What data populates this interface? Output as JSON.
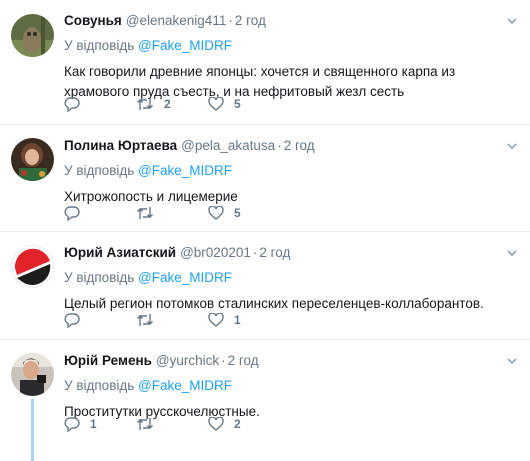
{
  "tweets": [
    {
      "name": "Совунья",
      "handle": "@elenakenig411",
      "time": "2 год",
      "reply_prefix": "У відповідь",
      "reply_to": "@Fake_MIDRF",
      "text": "Как говорили древние японцы: хочется и  священного карпа из храмового пруда съесть, и  на нефритовый жезл сесть",
      "reply_count": "",
      "retweet_count": "2",
      "like_count": "5"
    },
    {
      "name": "Полина Юртаева",
      "handle": "@pela_akatusa",
      "time": "2 год",
      "reply_prefix": "У відповідь",
      "reply_to": "@Fake_MIDRF",
      "text": "Хитрожопость и лицемерие",
      "reply_count": "",
      "retweet_count": "",
      "like_count": "5"
    },
    {
      "name": "Юрий Азиатский",
      "handle": "@br020201",
      "time": "2 год",
      "reply_prefix": "У відповідь",
      "reply_to": "@Fake_MIDRF",
      "text": "Целый регион потомков сталинских переселенцев-коллаборантов.",
      "reply_count": "",
      "retweet_count": "",
      "like_count": "1"
    },
    {
      "name": "Юрій Ремень",
      "handle": "@yurchick",
      "time": "2 год",
      "reply_prefix": "У відповідь",
      "reply_to": "@Fake_MIDRF",
      "text": "Проститутки русскочелюстные.",
      "reply_count": "1",
      "retweet_count": "",
      "like_count": "2"
    }
  ],
  "dot": "·",
  "colors": {
    "accent": "#1da1f2",
    "muted": "#657786",
    "divider": "#e6ecf0",
    "thread": "#a9d5f5"
  },
  "icons": [
    "reply-icon",
    "retweet-icon",
    "like-icon",
    "chevron-down-icon"
  ]
}
